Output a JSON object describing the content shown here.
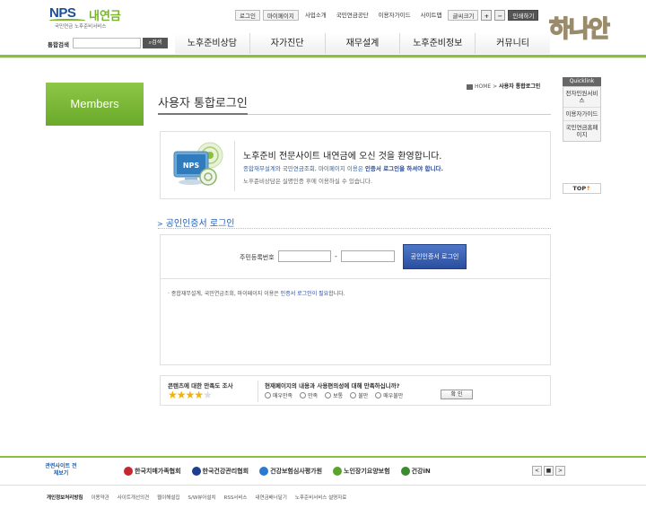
{
  "header": {
    "logo_brand": "NPS",
    "logo_brand2": "내연금",
    "logo_sub": "국민연금 노후준비서비스",
    "mascot": "하나안",
    "topnav": [
      "로그인",
      "마이페이지",
      "사업소개",
      "국민연금공단",
      "이용자가이드",
      "사이트맵",
      "글씨크기",
      "+",
      "−",
      "인쇄하기"
    ],
    "search_label": "통합검색",
    "search_button": "검색",
    "search_placeholder": ""
  },
  "gnb": [
    "노후준비상담",
    "자가진단",
    "재무설계",
    "노후준비정보",
    "커뮤니티"
  ],
  "sidebar": {
    "members": "Members"
  },
  "breadcrumb": {
    "home": "HOME",
    "sep": ">",
    "current": "사용자 통합로그인"
  },
  "page_title": "사용자 통합로그인",
  "welcome": {
    "heading": "노후준비 전문사이트 내연금에 오신 것을 환영합니다.",
    "line1_pre": "종합재무설계와 국민연금조회, 마이페이지 이용은 ",
    "line1_em": "인증서 로그인을 하셔야 합니다.",
    "line2": "노후준비상담은 실명인증 후에 이용하실 수 있습니다.",
    "graphic_label": "NPS"
  },
  "cert": {
    "title": "공인인증서 로그인",
    "rrn_label": "주민등록번호",
    "rrn_front": "",
    "rrn_back": "",
    "dash": "-",
    "login_button": "공인인증서 로그인"
  },
  "notice": {
    "pre": "· 종합재무설계, 국민연금조회, 마이페이지 이용은 ",
    "em": "인증서 로그인이 필요",
    "post": "합니다."
  },
  "survey": {
    "title": "콘텐츠에 대한 만족도 조사",
    "rating": 4,
    "max": 5,
    "question": "현재페이지의 내용과 사용편의성에 대해 만족하십니까?",
    "options": [
      "매우만족",
      "만족",
      "보통",
      "불만",
      "매우불만"
    ],
    "ok": "확 인"
  },
  "quicklink": {
    "head": "Quicklink",
    "items": [
      "전자민원서비스",
      "이용자가이드",
      "국민연금홈페이지"
    ],
    "top": "TOP",
    "top_arrow": "↑"
  },
  "footer": {
    "related": "관련사이트 전체보기",
    "partners": [
      {
        "name": "한국치매가족협회",
        "color": "#c8262f"
      },
      {
        "name": "한국건강관리협회",
        "color": "#1e3f8f"
      },
      {
        "name": "건강보험심사평가원",
        "color": "#2a7bd0"
      },
      {
        "name": "노인장기요양보험",
        "color": "#5aa42c"
      },
      {
        "name": "건강iN",
        "color": "#3b8c2e"
      }
    ],
    "pager": [
      "<",
      "■",
      ">"
    ],
    "links": [
      "개인정보처리방침",
      "이용약관",
      "사이트개선의견",
      "웹이해설집",
      "S/W뷰어설치",
      "RSS서비스",
      "내연금배너달기",
      "노후준비서비스 설명자료"
    ]
  },
  "colors": {
    "accent": "#8cbf3f",
    "link": "#2461b2",
    "button": "#2b4f9f"
  }
}
